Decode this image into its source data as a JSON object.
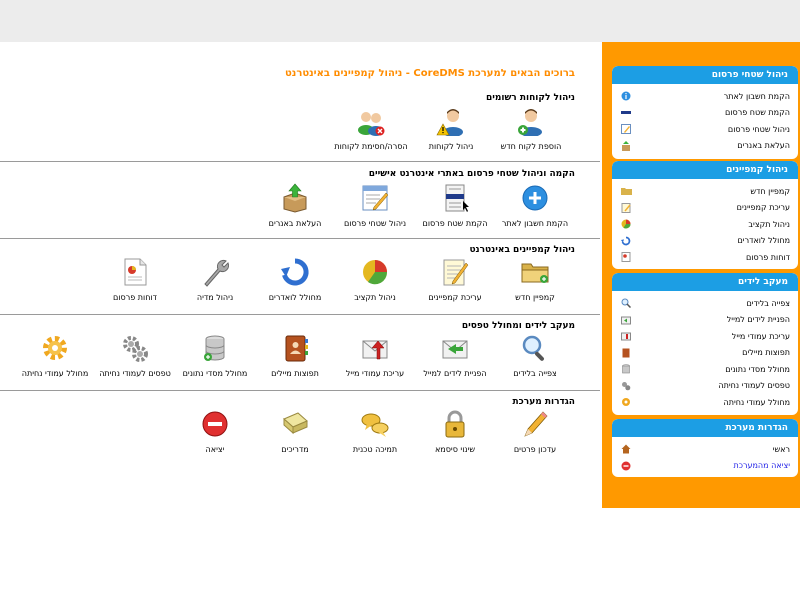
{
  "welcome": "ברוכים הבאים למערכת CoreDMS - ניהול קמפיינים באינטרנט",
  "sections": [
    {
      "title": "ניהול לקוחות רשומים",
      "items": [
        {
          "label": "הוספת לקוח חדש",
          "icon": "user-add-icon"
        },
        {
          "label": "ניהול לקוחות",
          "icon": "user-warning-icon"
        },
        {
          "label": "הסרה/חסימת לקוחות",
          "icon": "users-remove-icon"
        }
      ]
    },
    {
      "title": "הקמה וניהול שטחי פרסום באתרי אינטרנט אישיים",
      "items": [
        {
          "label": "הקמת חשבון לאתר",
          "icon": "plus-circle-icon"
        },
        {
          "label": "הקמת שטח פרסום",
          "icon": "document-cursor-icon"
        },
        {
          "label": "ניהול שטחי פרסום",
          "icon": "edit-window-icon"
        },
        {
          "label": "העלאת באנרים",
          "icon": "box-upload-icon"
        }
      ]
    },
    {
      "title": "ניהול קמפיינים באינטרנט",
      "items": [
        {
          "label": "קמפיין חדש",
          "icon": "folder-icon"
        },
        {
          "label": "עריכת קמפיינים",
          "icon": "notepad-pencil-icon"
        },
        {
          "label": "ניהול תקציב",
          "icon": "pie-chart-icon"
        },
        {
          "label": "מחולל לואדרים",
          "icon": "refresh-icon"
        },
        {
          "label": "ניהול מדיה",
          "icon": "wrench-icon"
        },
        {
          "label": "דוחות פרסום",
          "icon": "report-icon"
        }
      ]
    },
    {
      "title": "מעקב לידים ומחולל טפסים",
      "items": [
        {
          "label": "צפייה בלידים",
          "icon": "magnifier-icon"
        },
        {
          "label": "הפניית לידים למייל",
          "icon": "mail-forward-icon"
        },
        {
          "label": "עריכת עמודי מייל",
          "icon": "mail-edit-icon"
        },
        {
          "label": "תפוצות מיילים",
          "icon": "address-book-icon"
        },
        {
          "label": "מחולל מסדי נתונים",
          "icon": "database-icon"
        },
        {
          "label": "טפסים לעמודי נחיתה",
          "icon": "gears-icon"
        },
        {
          "label": "מחולל עמודי נחיתה",
          "icon": "gear-icon"
        }
      ]
    },
    {
      "title": "הגדרות מערכת",
      "items": [
        {
          "label": "עדכון פרטים",
          "icon": "pencil-icon"
        },
        {
          "label": "שינוי סיסמא",
          "icon": "lock-icon"
        },
        {
          "label": "תמיכה טכנית",
          "icon": "chat-bubbles-icon"
        },
        {
          "label": "מדריכים",
          "icon": "book-icon"
        },
        {
          "label": "יציאה",
          "icon": "exit-icon"
        }
      ]
    }
  ],
  "sidebar": [
    {
      "title": "ניהול שטחי פרסום",
      "items": [
        {
          "label": "הקמת חשבון לאתר",
          "icon": "info-icon"
        },
        {
          "label": "הקמת שטח פרסום",
          "icon": "bar-icon"
        },
        {
          "label": "ניהול שטחי פרסום",
          "icon": "edit-icon"
        },
        {
          "label": "העלאת באנרים",
          "icon": "box-icon"
        }
      ]
    },
    {
      "title": "ניהול קמפיינים",
      "items": [
        {
          "label": "קמפיין חדש",
          "icon": "folder-icon"
        },
        {
          "label": "עריכת קמפיינים",
          "icon": "notepad-icon"
        },
        {
          "label": "ניהול תקציב",
          "icon": "pie-icon"
        },
        {
          "label": "מחולל לואדרים",
          "icon": "refresh-icon"
        },
        {
          "label": "דוחות פרסום",
          "icon": "report-icon"
        }
      ]
    },
    {
      "title": "מעקב לידים",
      "items": [
        {
          "label": "צפייה בלידים",
          "icon": "magnifier-icon"
        },
        {
          "label": "הפניית לידים למייל",
          "icon": "mail-forward-icon"
        },
        {
          "label": "עריכת עמודי מייל",
          "icon": "mail-edit-icon"
        },
        {
          "label": "תפוצות מיילים",
          "icon": "address-book-icon"
        },
        {
          "label": "מחולל מסדי נתונים",
          "icon": "database-icon"
        },
        {
          "label": "טפסים לעמודי נחיתה",
          "icon": "gears-icon"
        },
        {
          "label": "מחולל עמודי נחיתה",
          "icon": "gear-icon"
        }
      ]
    },
    {
      "title": "הגדרות מערכת",
      "items": [
        {
          "label": "ראשי",
          "icon": "home-icon"
        },
        {
          "label": "יציאה מהמערכת",
          "icon": "exit-icon"
        }
      ]
    }
  ],
  "colors": {
    "accent": "#ff9900",
    "header_blue": "#1c9ee4",
    "welcome": "#ff8c00",
    "link": "#1e1ee6"
  }
}
